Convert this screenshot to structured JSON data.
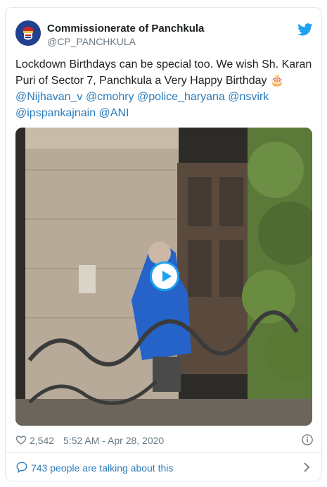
{
  "account": {
    "name": "Commissionerate of Panchkula",
    "handle": "@CP_PANCHKULA",
    "avatar_icon": "police-badge-avatar"
  },
  "tweet": {
    "text_lead": "Lockdown Birthdays can be special too. We wish Sh. Karan Puri of Sector 7, Panchkula a Very Happy Birthday ",
    "emoji": "🎂",
    "mentions": [
      "@Nijhavan_v",
      "@cmohry",
      "@police_haryana",
      "@nsvirk",
      "@ipspankajnain",
      "@ANI"
    ]
  },
  "media": {
    "type": "video",
    "play_icon": "play-icon"
  },
  "stats": {
    "likes": "2,542",
    "timestamp": "5:52 AM - Apr 28, 2020"
  },
  "footer": {
    "conversation": "743 people are talking about this"
  },
  "colors": {
    "accent": "#1da1f2",
    "link": "#2b7bb9",
    "muted": "#697882",
    "border": "#e1e8ed"
  }
}
